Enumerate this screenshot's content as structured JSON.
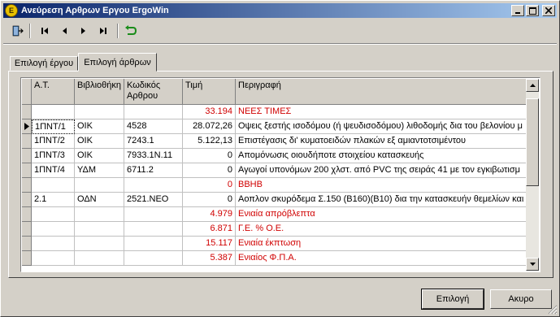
{
  "window": {
    "title": "Ανεύρεση Αρθρων Εργου ErgoWin",
    "controls": {
      "minimize": "_",
      "maximize": "□",
      "close": "×"
    }
  },
  "toolbar": {
    "icons": [
      "exit-door-icon",
      "first-record-icon",
      "previous-record-icon",
      "next-record-icon",
      "last-record-icon",
      "refresh-icon"
    ]
  },
  "tabs": [
    {
      "label": "Επιλογή έργου",
      "active": false
    },
    {
      "label": "Επιλογή άρθρων",
      "active": true
    }
  ],
  "grid": {
    "columns": [
      "Α.Τ.",
      "Βιβλιοθήκη",
      "Κωδικός Αρθρου",
      "Τιμή",
      "Περιγραφή"
    ],
    "rows": [
      {
        "at": "",
        "lib": "",
        "code": "",
        "price": "33.194",
        "desc": "ΝΕΕΣ ΤΙΜΕΣ",
        "red": true,
        "current": false
      },
      {
        "at": "1ΠΝΤ/1",
        "lib": "ΟΙΚ",
        "code": "4528",
        "price": "28.072,26",
        "desc": "Οψεις ξεστής ισοδόμου (ή ψευδισοδόμου) λιθοδομής δια του βελονίου μ",
        "red": false,
        "current": true
      },
      {
        "at": "1ΠΝΤ/2",
        "lib": "ΟΙΚ",
        "code": "7243.1",
        "price": "5.122,13",
        "desc": "Επιστέγασις δι' κυματοειδών πλακών εξ αμιαντοτσιμέντου",
        "red": false,
        "current": false
      },
      {
        "at": "1ΠΝΤ/3",
        "lib": "ΟΙΚ",
        "code": "7933.1Ν.11",
        "price": "0",
        "desc": "Απομόνωσις οιουδήποτε στοιχείου κατασκευής",
        "red": false,
        "current": false
      },
      {
        "at": "1ΠΝΤ/4",
        "lib": "ΥΔΜ",
        "code": "6711.2",
        "price": "0",
        "desc": "Αγωγοί υπονόμων 200 χλστ. από PVC της σειράς 41 με τον εγκιβωτισμ",
        "red": false,
        "current": false
      },
      {
        "at": "",
        "lib": "",
        "code": "",
        "price": "0",
        "desc": "ΒΒΗΒ",
        "red": true,
        "current": false
      },
      {
        "at": "2.1",
        "lib": "ΟΔΝ",
        "code": "2521.ΝΕΟ",
        "price": "0",
        "desc": "Αοπλον σκυρόδεμα Σ.150 (Β160)(Β10) δια την κατασκευήν θεμελίων και",
        "red": false,
        "current": false
      },
      {
        "at": "",
        "lib": "",
        "code": "",
        "price": "4.979",
        "desc": "Ενιαία απρόβλεπτα",
        "red": true,
        "current": false
      },
      {
        "at": "",
        "lib": "",
        "code": "",
        "price": "6.871",
        "desc": "Γ.Ε. % Ο.Ε.",
        "red": true,
        "current": false
      },
      {
        "at": "",
        "lib": "",
        "code": "",
        "price": "15.117",
        "desc": "Ενιαία έκπτωση",
        "red": true,
        "current": false
      },
      {
        "at": "",
        "lib": "",
        "code": "",
        "price": "5.387",
        "desc": "Ενιαίος Φ.Π.Α.",
        "red": true,
        "current": false
      }
    ]
  },
  "buttons": {
    "ok": "Επιλογή",
    "cancel": "Ακυρο"
  },
  "colors": {
    "accent_red": "#d00000",
    "title_start": "#0a246a",
    "title_end": "#a6caf0"
  }
}
